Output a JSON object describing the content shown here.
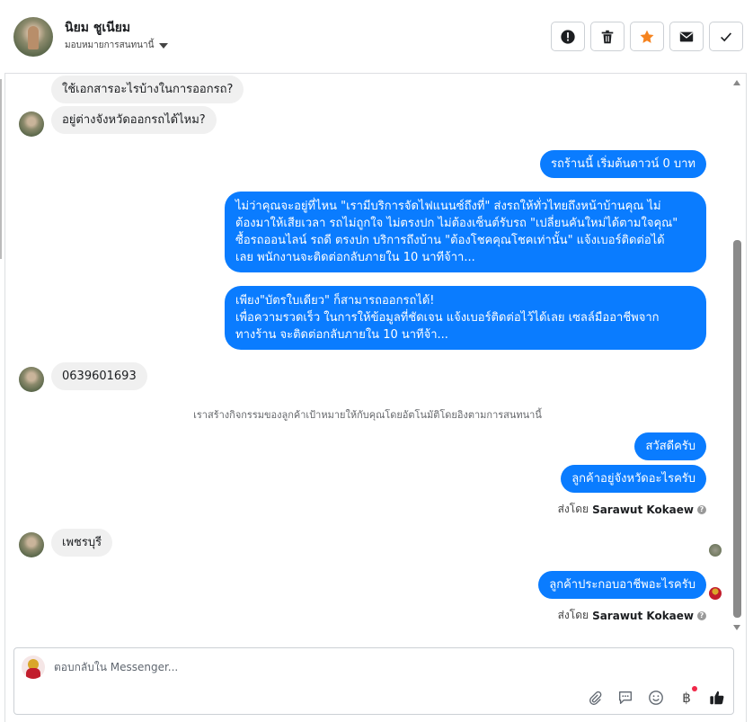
{
  "header": {
    "contact_name": "นิยม ชูเนียม",
    "assign_label": "มอบหมายการสนทนานี้"
  },
  "messages": [
    {
      "dir": "in",
      "text": "ใช้เอกสารอะไรบ้างในการออกรถ?"
    },
    {
      "dir": "in",
      "text": "อยู่ต่างจังหวัดออกรถได้ไหม?"
    },
    {
      "dir": "out",
      "text": "รถร้านนี้ เริ่มต้นดาวน์ 0 บาท"
    },
    {
      "dir": "out",
      "lines": [
        "ไม่ว่าคุณจะอยู่ที่ไหน \"เรามีบริการจัดไฟแนนซ์ถึงที่\"  ส่งรถให้ทั่วไทยถึงหน้าบ้านคุณ ไม่",
        "ต้องมาให้เสียเวลา รถไม่ถูกใจ ไม่ตรงปก ไม่ต้องเซ็นต์รับรถ \"เปลี่ยนคันใหม่ได้ตามใจคุณ\"",
        "ซื้อรถออนไลน์ รถดี ตรงปก บริการถึงบ้าน \"ต้องโชคคุณโชคเท่านั้น\" แจ้งเบอร์ติดต่อได้",
        "เลย พนักงานจะติดต่อกลับภายใน 10 นาทีจ้าา..."
      ]
    },
    {
      "dir": "out",
      "lines": [
        "เพียง\"บัตรใบเดียว\" ก็สามารถออกรถได้!",
        "เพื่อความรวดเร็ว ในการให้ข้อมูลที่ชัดเจน แจ้งเบอร์ติดต่อไว้ได้เลย เซลล์มืออาชีพจาก",
        "ทางร้าน จะติดต่อกลับภายใน 10 นาทีจ้า..."
      ]
    },
    {
      "dir": "in",
      "text": "0639601693"
    },
    {
      "dir": "out",
      "text": "สวัสดีครับ"
    },
    {
      "dir": "out",
      "text": "ลูกค้าอยู่จังหวัดอะไรครับ"
    },
    {
      "dir": "in",
      "text": "เพชรบุรี"
    },
    {
      "dir": "out",
      "text": "ลูกค้าประกอบอาชีพอะไรครับ"
    }
  ],
  "system_note": "เราสร้างกิจกรรมของลูกค้าเป้าหมายให้กับคุณโดยอัตโนมัติโดยอิงตามการสนทนานี้",
  "sent_by": {
    "prefix": "ส่งโดย",
    "name": "Sarawut Kokaew"
  },
  "composer": {
    "placeholder": "ตอบกลับใน Messenger..."
  },
  "toolbar_icons": [
    "alert-icon",
    "trash-icon",
    "star-icon",
    "mail-icon",
    "check-icon"
  ],
  "composer_icons": [
    "attachment-icon",
    "saved-replies-icon",
    "emoji-icon",
    "baht-icon",
    "like-icon"
  ],
  "composer_baht_symbol": "฿",
  "colors": {
    "outgoing": "#0a7cff",
    "incoming": "#f0f0f0",
    "star": "#f5831f",
    "notification_dot": "#f02849"
  }
}
